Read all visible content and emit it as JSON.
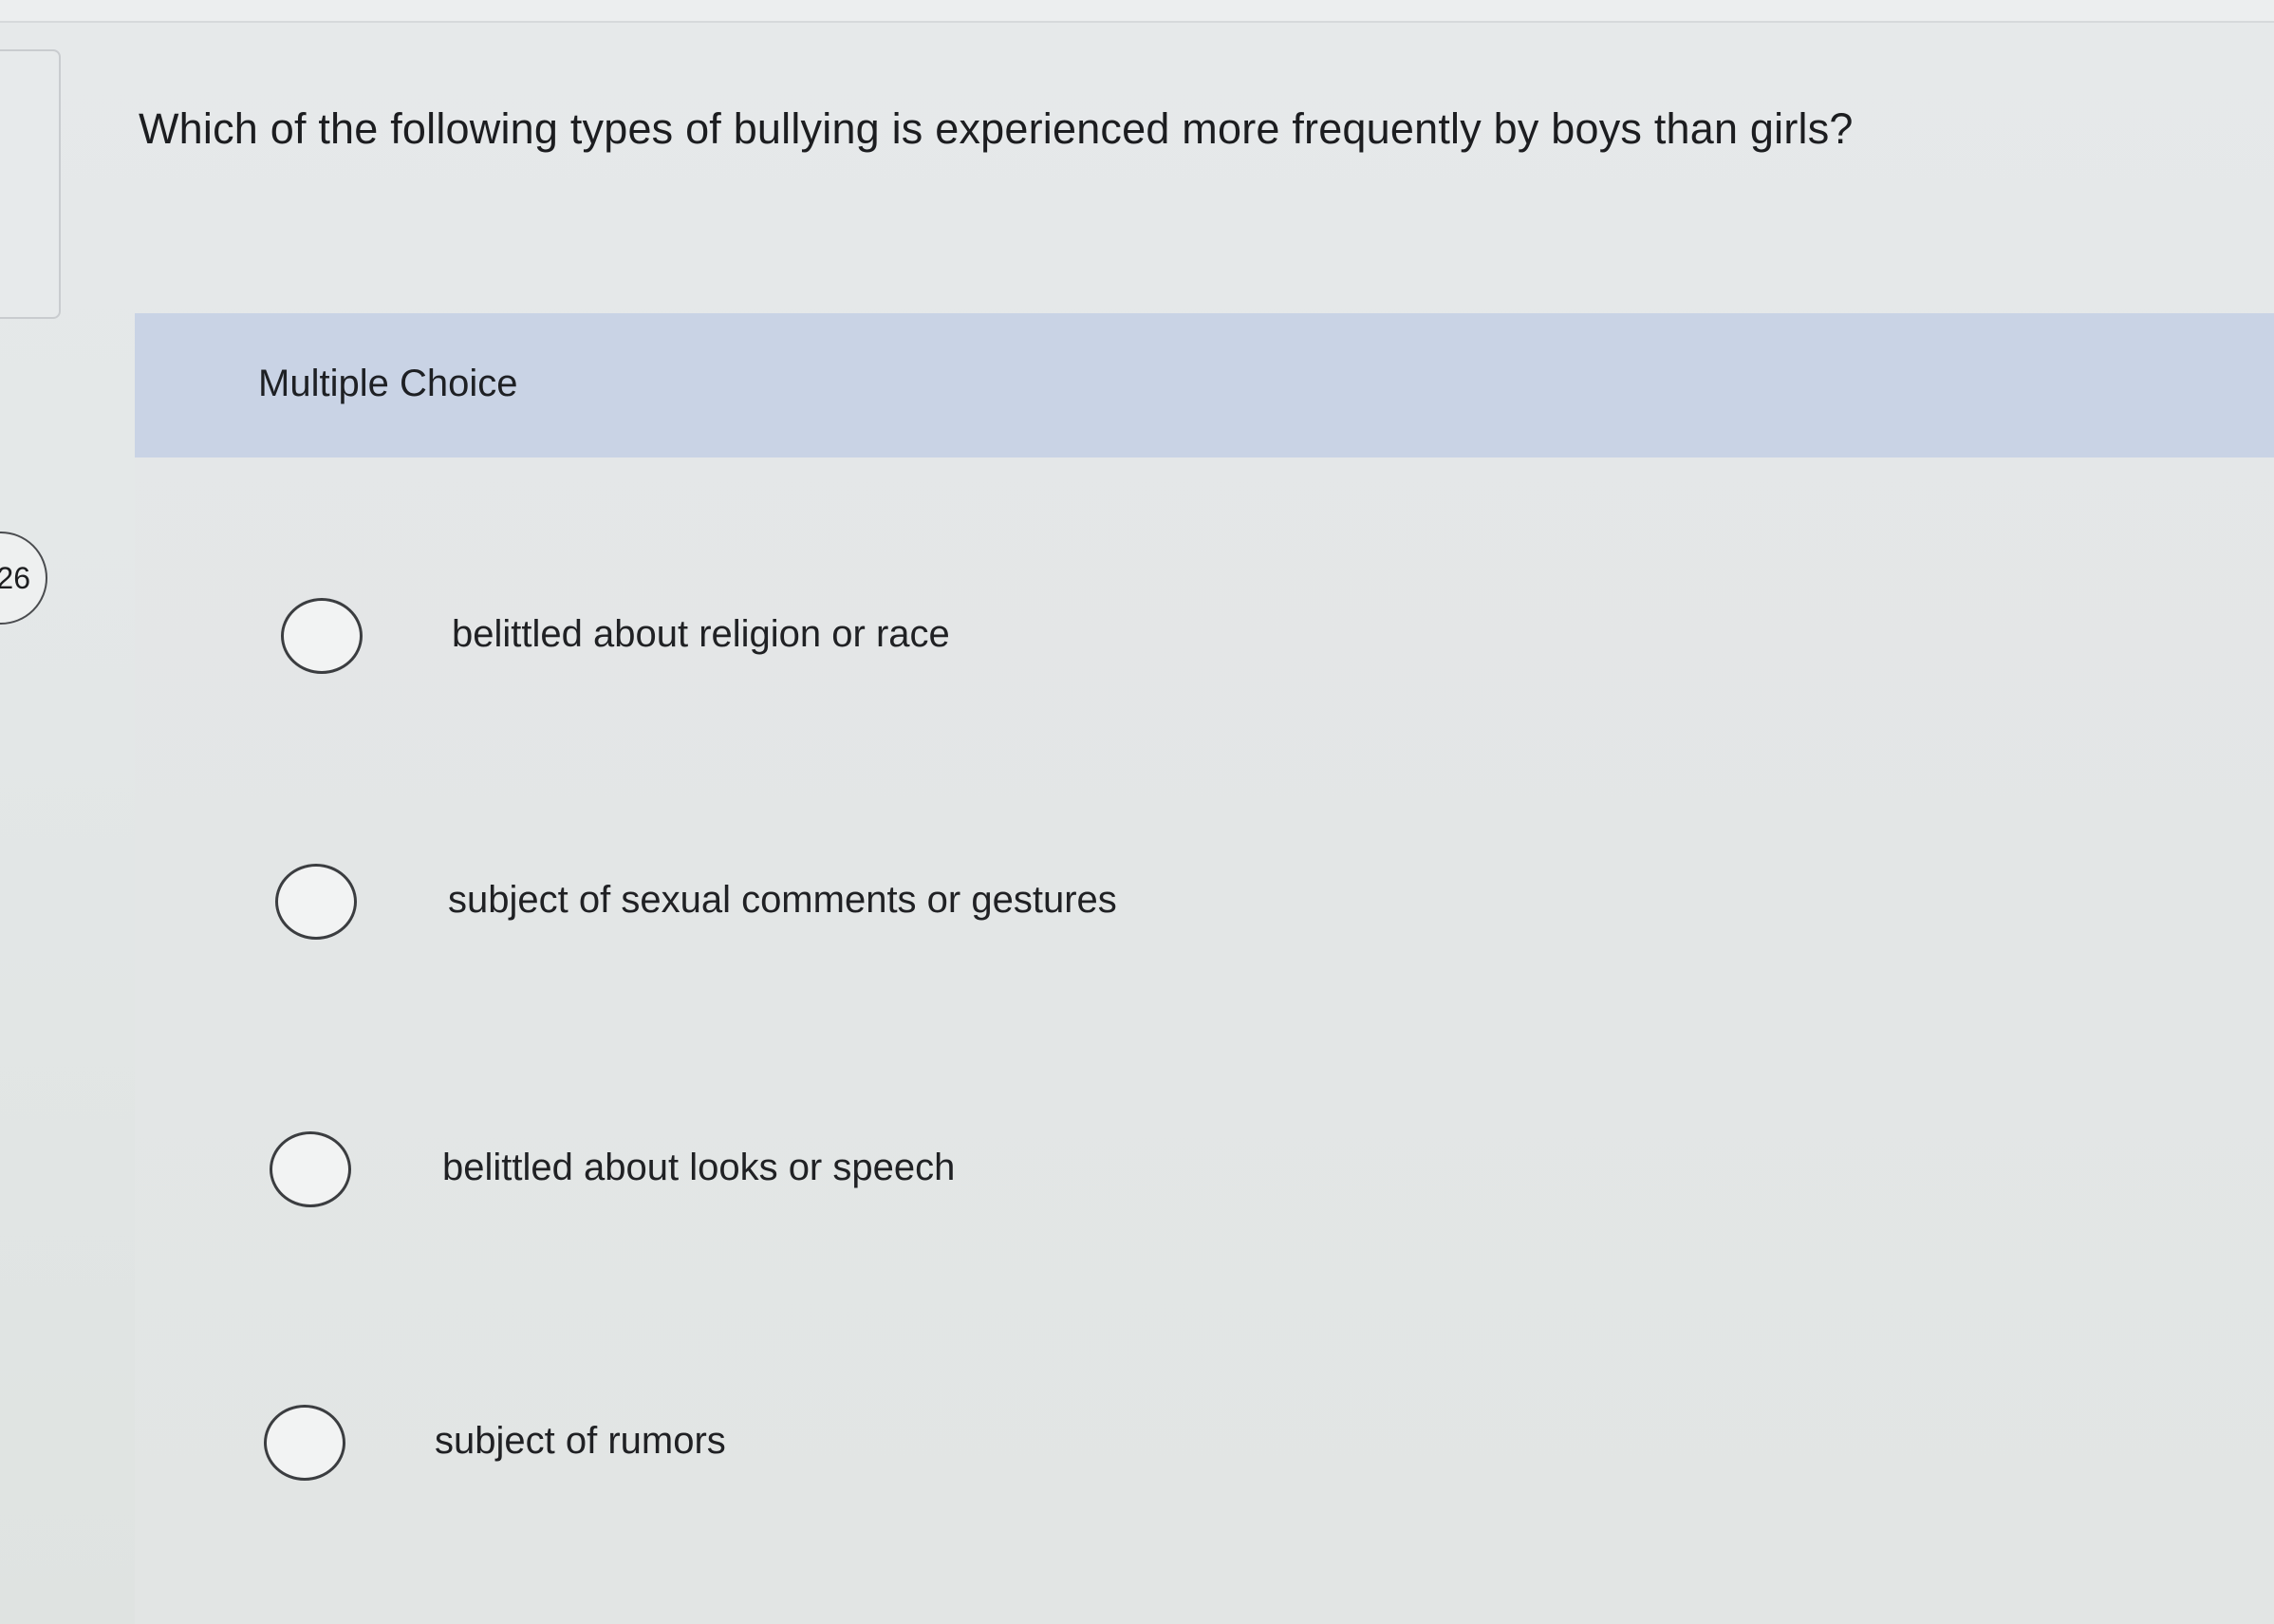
{
  "question": {
    "number": "26",
    "prompt": "Which of the following types of bullying is experienced more frequently by boys than girls?"
  },
  "panel": {
    "header_label": "Multiple Choice"
  },
  "choices": [
    {
      "label": "belittled about religion or race"
    },
    {
      "label": "subject of sexual comments or gestures"
    },
    {
      "label": "belittled about looks or speech"
    },
    {
      "label": "subject of rumors"
    }
  ],
  "colors": {
    "header_band": "#c9d3e5",
    "background": "#e3e7e7",
    "text": "#1e1f22"
  }
}
